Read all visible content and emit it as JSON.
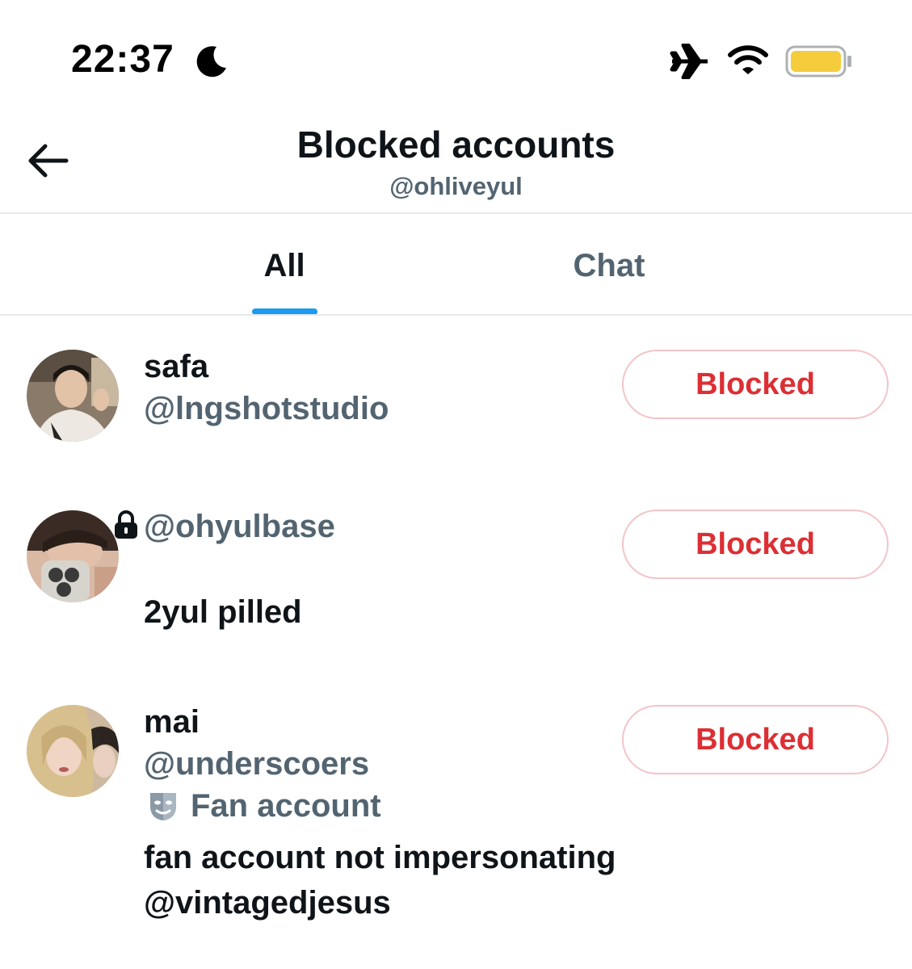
{
  "status_bar": {
    "time": "22:37",
    "icons": [
      "moon-icon",
      "airplane-icon",
      "wifi-icon",
      "battery-icon"
    ],
    "battery_color": "#f5cc3b"
  },
  "header": {
    "title": "Blocked accounts",
    "subtitle": "@ohliveyul"
  },
  "tabs": [
    {
      "label": "All",
      "selected": true
    },
    {
      "label": "Chat",
      "selected": false
    }
  ],
  "accounts": [
    {
      "name": "safa",
      "handle": "@lngshotstudio",
      "button": "Blocked"
    },
    {
      "handle": "@ohyulbase",
      "protected": true,
      "bio": "2yul pilled",
      "button": "Blocked"
    },
    {
      "name": "mai",
      "handle": "@underscoers",
      "label": "Fan account",
      "bio_line1": "fan account not impersonating",
      "bio_line2": "@vintagedjesus",
      "button": "Blocked"
    }
  ],
  "colors": {
    "accent": "#1d9bf0",
    "blocked_text": "#dc2f34",
    "blocked_border": "#f4c4c8",
    "secondary_text": "#536471"
  }
}
